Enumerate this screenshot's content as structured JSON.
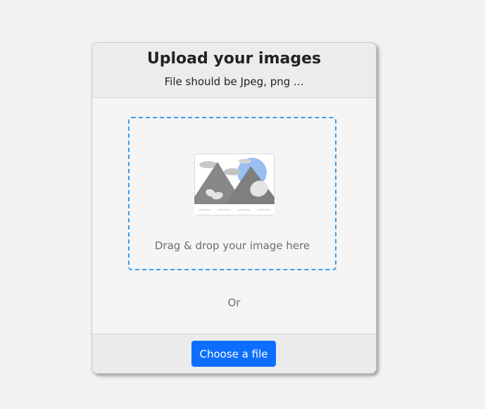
{
  "header": {
    "title": "Upload your images",
    "subtitle": "File should be Jpeg, png ..."
  },
  "dropzone": {
    "icon": "image-placeholder-icon",
    "label": "Drag & drop your image here"
  },
  "divider_text": "Or",
  "footer": {
    "choose_button_label": "Choose a file"
  },
  "colors": {
    "accent": "#0d6efd",
    "dropzone_border": "#3b9be8"
  }
}
